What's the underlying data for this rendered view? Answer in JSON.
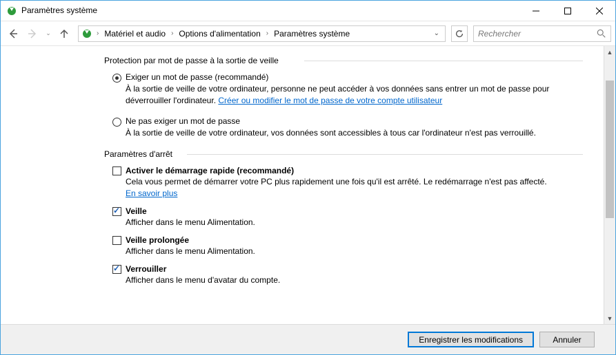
{
  "window": {
    "title": "Paramètres système"
  },
  "breadcrumb": {
    "items": [
      "Matériel et audio",
      "Options d'alimentation",
      "Paramètres système"
    ]
  },
  "search": {
    "placeholder": "Rechercher"
  },
  "section1": {
    "header": "Protection par mot de passe à la sortie de veille",
    "radio1": {
      "label": "Exiger un mot de passe (recommandé)",
      "desc_pre": "À la sortie de veille de votre ordinateur, personne ne peut accéder à vos données sans entrer un mot de passe pour déverrouiller l'ordinateur. ",
      "link": "Créer ou modifier le mot de passe de votre compte utilisateur",
      "checked": true
    },
    "radio2": {
      "label": "Ne pas exiger un mot de passe",
      "desc": "À la sortie de veille de votre ordinateur, vos données sont accessibles à tous car l'ordinateur n'est pas verrouillé.",
      "checked": false
    }
  },
  "section2": {
    "header": "Paramètres d'arrêt",
    "check1": {
      "label": "Activer le démarrage rapide (recommandé)",
      "desc_pre": "Cela vous permet de démarrer votre PC plus rapidement une fois qu'il est arrêté. Le redémarrage n'est pas affecté. ",
      "link": "En savoir plus",
      "checked": false
    },
    "check2": {
      "label": "Veille",
      "desc": "Afficher dans le menu Alimentation.",
      "checked": true
    },
    "check3": {
      "label": "Veille prolongée",
      "desc": "Afficher dans le menu Alimentation.",
      "checked": false
    },
    "check4": {
      "label": "Verrouiller",
      "desc": "Afficher dans le menu d'avatar du compte.",
      "checked": true
    }
  },
  "footer": {
    "save": "Enregistrer les modifications",
    "cancel": "Annuler"
  }
}
